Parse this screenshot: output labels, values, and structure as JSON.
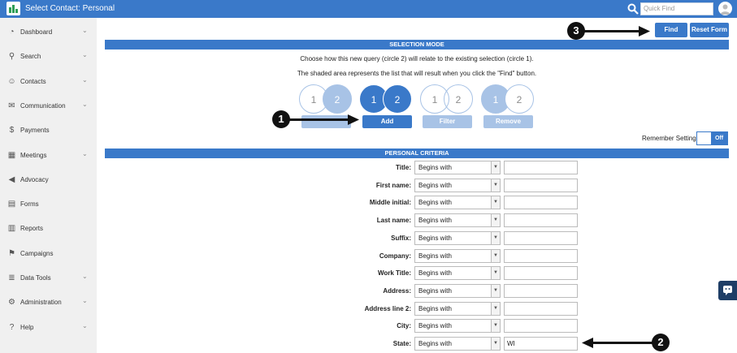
{
  "app": {
    "title": "Select Contact: Personal",
    "quick_find_placeholder": "Quick Find"
  },
  "sidebar": {
    "items": [
      {
        "label": "Dashboard",
        "icon": "dashboard-icon",
        "has_chevron": true
      },
      {
        "label": "Search",
        "icon": "search-icon",
        "has_chevron": true
      },
      {
        "label": "Contacts",
        "icon": "contacts-icon",
        "has_chevron": true
      },
      {
        "label": "Communication",
        "icon": "envelope-icon",
        "has_chevron": true
      },
      {
        "label": "Payments",
        "icon": "dollar-icon",
        "has_chevron": false
      },
      {
        "label": "Meetings",
        "icon": "calendar-icon",
        "has_chevron": true
      },
      {
        "label": "Advocacy",
        "icon": "megaphone-icon",
        "has_chevron": false
      },
      {
        "label": "Forms",
        "icon": "form-icon",
        "has_chevron": false
      },
      {
        "label": "Reports",
        "icon": "chart-icon",
        "has_chevron": false
      },
      {
        "label": "Campaigns",
        "icon": "flag-icon",
        "has_chevron": false
      },
      {
        "label": "Data Tools",
        "icon": "database-icon",
        "has_chevron": true
      },
      {
        "label": "Administration",
        "icon": "gear-icon",
        "has_chevron": true
      },
      {
        "label": "Help",
        "icon": "help-icon",
        "has_chevron": true
      }
    ]
  },
  "toolbar": {
    "find_label": "Find",
    "reset_label": "Reset Form"
  },
  "selection_mode": {
    "header": "SELECTION MODE",
    "line1": "Choose how this new query (circle 2) will relate to the existing selection (circle 1).",
    "line2": "The shaded area represents the list that will result when you click the \"Find\" button.",
    "circle1": "1",
    "circle2": "2",
    "options": [
      {
        "label": "",
        "state": "pale"
      },
      {
        "label": "Add",
        "state": "active"
      },
      {
        "label": "Filter",
        "state": "pale"
      },
      {
        "label": "Remove",
        "state": "pale"
      }
    ],
    "remember_label": "Remember Setting",
    "toggle_label": "Off"
  },
  "criteria": {
    "header": "PERSONAL CRITERIA",
    "fields": [
      {
        "label": "Title:",
        "operator": "Begins with",
        "value": ""
      },
      {
        "label": "First name:",
        "operator": "Begins with",
        "value": ""
      },
      {
        "label": "Middle initial:",
        "operator": "Begins with",
        "value": ""
      },
      {
        "label": "Last name:",
        "operator": "Begins with",
        "value": ""
      },
      {
        "label": "Suffix:",
        "operator": "Begins with",
        "value": ""
      },
      {
        "label": "Company:",
        "operator": "Begins with",
        "value": ""
      },
      {
        "label": "Work Title:",
        "operator": "Begins with",
        "value": ""
      },
      {
        "label": "Address:",
        "operator": "Begins with",
        "value": ""
      },
      {
        "label": "Address line 2:",
        "operator": "Begins with",
        "value": ""
      },
      {
        "label": "City:",
        "operator": "Begins with",
        "value": ""
      },
      {
        "label": "State:",
        "operator": "Begins with",
        "value": "WI"
      }
    ]
  },
  "annotations": {
    "m1": "1",
    "m2": "2",
    "m3": "3"
  },
  "colors": {
    "brand_blue": "#3a79c9",
    "pale_blue": "#a8c3e6",
    "sidebar_bg": "#f0f0f0"
  }
}
